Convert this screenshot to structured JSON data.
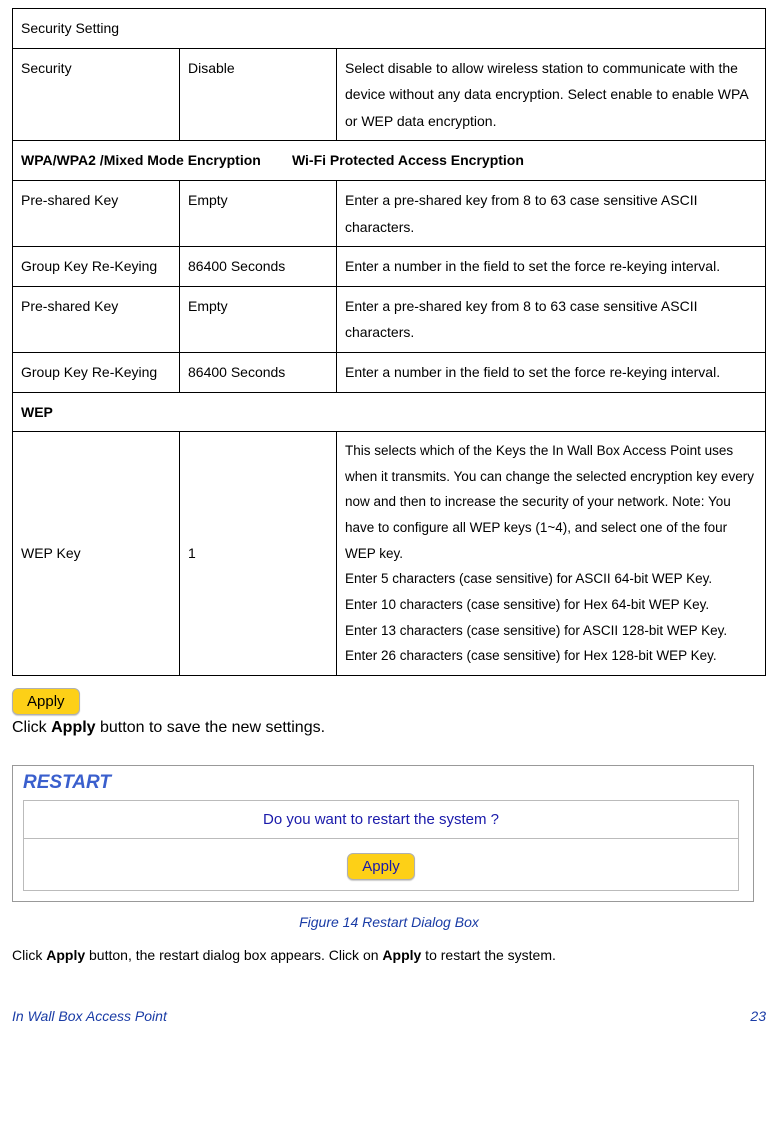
{
  "table": {
    "securitySettingHeader": "Security Setting",
    "row1": {
      "c1": "Security",
      "c2": "Disable",
      "c3": "Select disable to allow wireless station to communicate with the device without any data encryption. Select enable to enable WPA or WEP data encryption."
    },
    "wpaHeader": "WPA/WPA2 /Mixed Mode Encryption        Wi-Fi Protected Access Encryption",
    "row2": {
      "c1": "Pre-shared Key",
      "c2": "Empty",
      "c3": "Enter a pre-shared key from 8 to 63 case sensitive ASCII characters."
    },
    "row3": {
      "c1": "Group Key Re-Keying",
      "c2": "86400 Seconds",
      "c3": "Enter a number in the field to set the force re-keying interval."
    },
    "row4": {
      "c1": "Pre-shared Key",
      "c2": "Empty",
      "c3": "Enter a pre-shared key from 8 to 63 case sensitive ASCII characters."
    },
    "row5": {
      "c1": "Group Key Re-Keying",
      "c2": "86400 Seconds",
      "c3": "Enter a number in the field to set the force re-keying interval."
    },
    "wepHeader": "WEP",
    "row6": {
      "c1": "WEP Key",
      "c2": "1",
      "c3": "This selects which of the Keys the In Wall Box Access Point uses when it transmits. You can change the selected encryption key every now and then to increase the security of your network. Note: You have to configure all WEP keys (1~4), and select one of the four WEP key.\nEnter 5 characters (case sensitive) for ASCII 64-bit WEP Key.\nEnter 10 characters (case sensitive) for Hex 64-bit WEP Key.\nEnter 13 characters (case sensitive) for ASCII 128-bit WEP Key.\nEnter 26 characters (case sensitive) for Hex 128-bit WEP Key."
    }
  },
  "applyBtn1": "Apply",
  "applyLine": {
    "prefix": "Click ",
    "bold": "Apply",
    "suffix": " button to save the new settings."
  },
  "restart": {
    "title": "RESTART",
    "question": "Do you want to restart the system ?",
    "applyBtn": "Apply"
  },
  "figureCaption": "Figure 14 Restart Dialog Box",
  "instruction": {
    "p1": "Click ",
    "b1": "Apply",
    "p2": " button, the restart dialog box appears. Click on ",
    "b2": "Apply",
    "p3": " to restart the system."
  },
  "footer": {
    "left": "In Wall Box Access Point",
    "right": "23"
  }
}
